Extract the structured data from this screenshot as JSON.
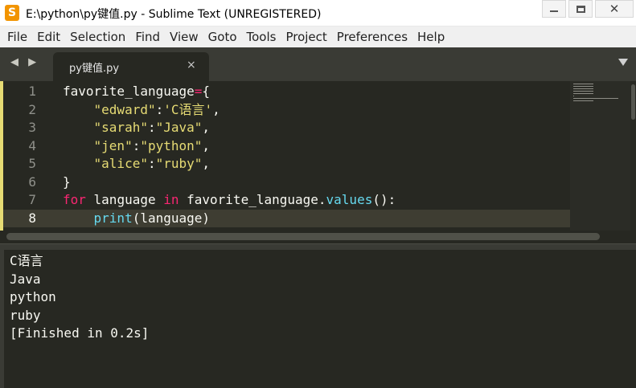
{
  "window": {
    "title": "E:\\python\\py键值.py - Sublime Text (UNREGISTERED)",
    "app_icon_glyph": "S",
    "app_icon_color": "#f29400"
  },
  "menu": {
    "items": [
      "File",
      "Edit",
      "Selection",
      "Find",
      "View",
      "Goto",
      "Tools",
      "Project",
      "Preferences",
      "Help"
    ]
  },
  "tabs": {
    "nav_arrows": "◀ ▶",
    "active": {
      "label": "py键值.py",
      "close": "×"
    }
  },
  "editor": {
    "line_numbers": [
      "1",
      "2",
      "3",
      "4",
      "5",
      "6",
      "7",
      "8"
    ],
    "current_line": 8,
    "colors": {
      "background": "#272822",
      "string": "#e6db74",
      "keyword": "#f92672",
      "builtin": "#66d9ef",
      "text": "#f8f8f2"
    },
    "lines": [
      [
        {
          "t": "favorite_language",
          "c": "plain"
        },
        {
          "t": "=",
          "c": "kw"
        },
        {
          "t": "{",
          "c": "plain"
        }
      ],
      [
        {
          "t": "    ",
          "c": "plain"
        },
        {
          "t": "\"edward\"",
          "c": "str"
        },
        {
          "t": ":",
          "c": "plain"
        },
        {
          "t": "'C语言'",
          "c": "str"
        },
        {
          "t": ",",
          "c": "plain"
        }
      ],
      [
        {
          "t": "    ",
          "c": "plain"
        },
        {
          "t": "\"sarah\"",
          "c": "str"
        },
        {
          "t": ":",
          "c": "plain"
        },
        {
          "t": "\"Java\"",
          "c": "str"
        },
        {
          "t": ",",
          "c": "plain"
        }
      ],
      [
        {
          "t": "    ",
          "c": "plain"
        },
        {
          "t": "\"jen\"",
          "c": "str"
        },
        {
          "t": ":",
          "c": "plain"
        },
        {
          "t": "\"python\"",
          "c": "str"
        },
        {
          "t": ",",
          "c": "plain"
        }
      ],
      [
        {
          "t": "    ",
          "c": "plain"
        },
        {
          "t": "\"alice\"",
          "c": "str"
        },
        {
          "t": ":",
          "c": "plain"
        },
        {
          "t": "\"ruby\"",
          "c": "str"
        },
        {
          "t": ",",
          "c": "plain"
        }
      ],
      [
        {
          "t": "}",
          "c": "plain"
        }
      ],
      [
        {
          "t": "for",
          "c": "kw"
        },
        {
          "t": " language ",
          "c": "plain"
        },
        {
          "t": "in",
          "c": "kw"
        },
        {
          "t": " favorite_language.",
          "c": "plain"
        },
        {
          "t": "values",
          "c": "fn"
        },
        {
          "t": "():",
          "c": "plain"
        }
      ],
      [
        {
          "t": "    ",
          "c": "plain"
        },
        {
          "t": "print",
          "c": "fn"
        },
        {
          "t": "(language)",
          "c": "plain"
        }
      ]
    ]
  },
  "output": {
    "lines": [
      "C语言",
      "Java",
      "python",
      "ruby",
      "[Finished in 0.2s]"
    ]
  }
}
